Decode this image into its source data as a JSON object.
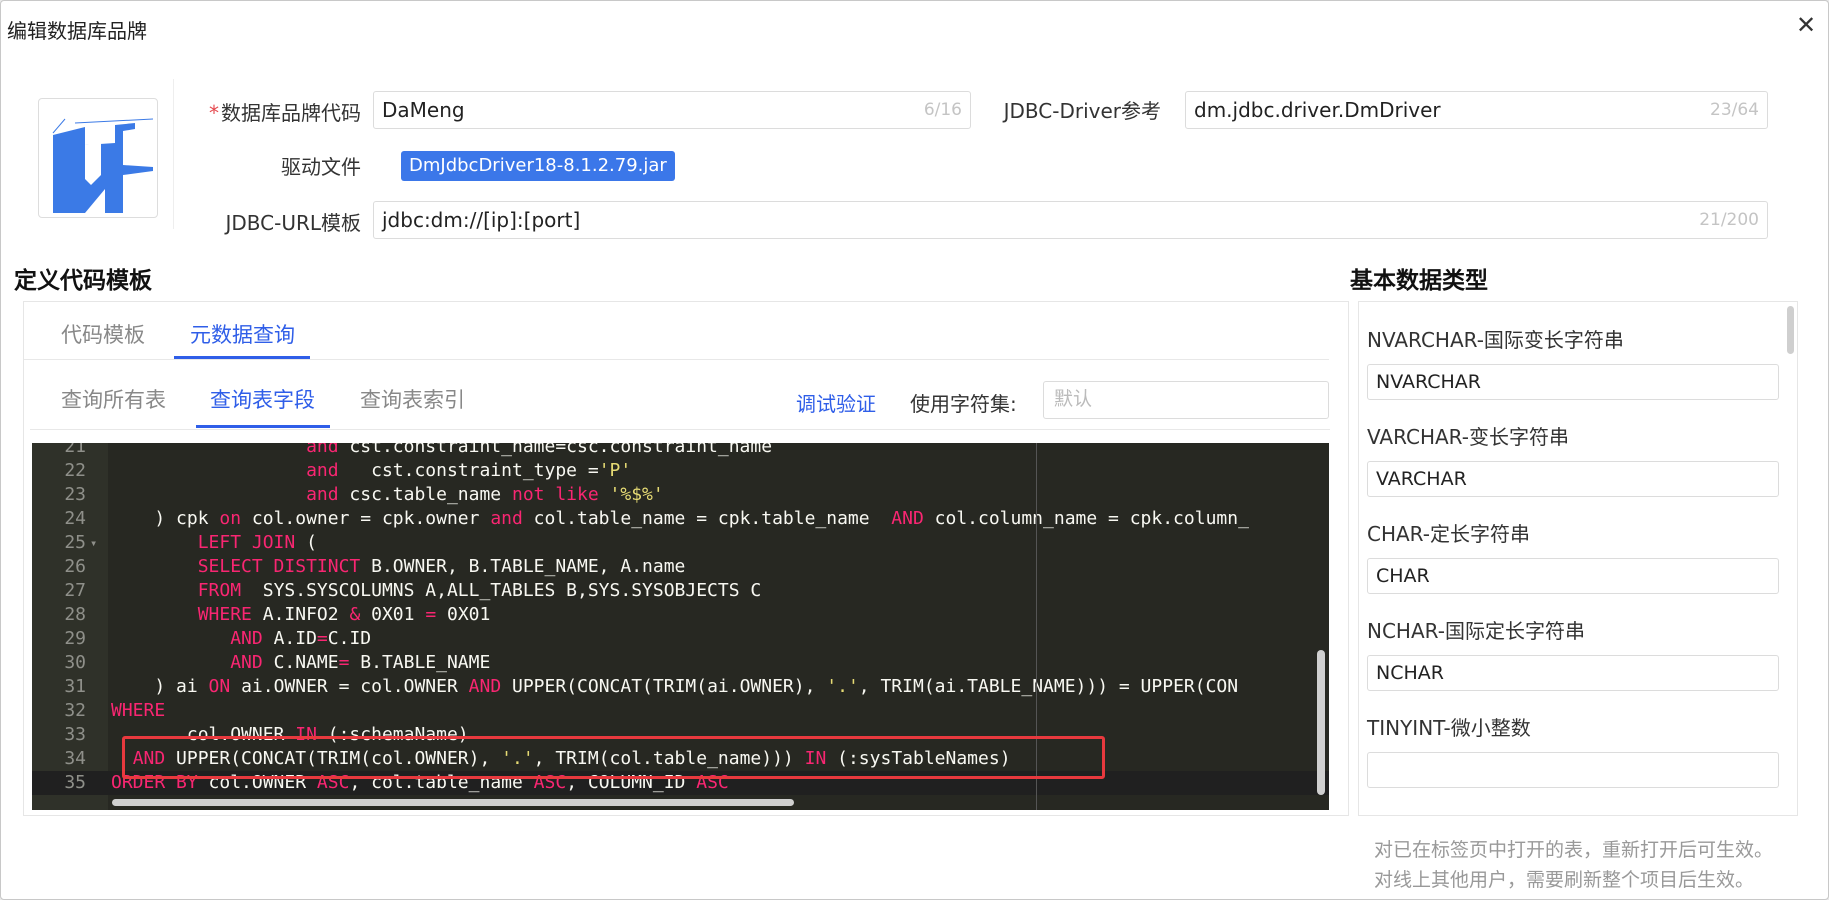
{
  "dialog": {
    "title": "编辑数据库品牌",
    "close_label": "✕"
  },
  "brand_code": {
    "label": "数据库品牌代码",
    "value": "DaMeng",
    "count": "6/16"
  },
  "jdbc_driver": {
    "label": "JDBC-Driver参考",
    "value": "dm.jdbc.driver.DmDriver",
    "count": "23/64"
  },
  "driver_file": {
    "label": "驱动文件",
    "file": "DmJdbcDriver18-8.1.2.79.jar"
  },
  "jdbc_url": {
    "label": "JDBC-URL模板",
    "value": "jdbc:dm://[ip]:[port]",
    "count": "21/200"
  },
  "sections": {
    "code_template": "定义代码模板",
    "basic_types": "基本数据类型"
  },
  "tabs_main": [
    "代码模板",
    "元数据查询"
  ],
  "tabs_sub": [
    "查询所有表",
    "查询表字段",
    "查询表索引"
  ],
  "toolbar": {
    "debug_label": "调试验证",
    "charset_label": "使用字符集:",
    "charset_placeholder": "默认"
  },
  "editor": {
    "lines": [
      {
        "n": "21",
        "t": [
          [
            "",
            "                  "
          ],
          [
            "kw",
            "and"
          ],
          [
            "",
            " cst.constraint_name=csc.constraint_name"
          ]
        ]
      },
      {
        "n": "22",
        "t": [
          [
            "",
            "                  "
          ],
          [
            "kw",
            "and"
          ],
          [
            "",
            "   cst.constraint_type ="
          ],
          [
            "str",
            "'P'"
          ]
        ]
      },
      {
        "n": "23",
        "t": [
          [
            "",
            "                  "
          ],
          [
            "kw",
            "and"
          ],
          [
            "",
            " csc.table_name "
          ],
          [
            "kw",
            "not like"
          ],
          [
            "",
            " "
          ],
          [
            "str",
            "'%$%'"
          ]
        ]
      },
      {
        "n": "24",
        "t": [
          [
            "",
            "    ) cpk "
          ],
          [
            "kw",
            "on"
          ],
          [
            "",
            " col.owner = cpk.owner "
          ],
          [
            "kw",
            "and"
          ],
          [
            "",
            " col.table_name = cpk.table_name  "
          ],
          [
            "kw",
            "AND"
          ],
          [
            "",
            " col.column_name = cpk.column_"
          ]
        ]
      },
      {
        "n": "25",
        "fold": true,
        "t": [
          [
            "",
            "        "
          ],
          [
            "kw",
            "LEFT JOIN"
          ],
          [
            "",
            " ("
          ]
        ]
      },
      {
        "n": "26",
        "t": [
          [
            "",
            "        "
          ],
          [
            "kw",
            "SELECT DISTINCT"
          ],
          [
            "",
            " B.OWNER, B.TABLE_NAME, A.name"
          ]
        ]
      },
      {
        "n": "27",
        "t": [
          [
            "",
            "        "
          ],
          [
            "kw",
            "FROM"
          ],
          [
            "",
            "  SYS.SYSCOLUMNS A,ALL_TABLES B,SYS.SYSOBJECTS C"
          ]
        ]
      },
      {
        "n": "28",
        "t": [
          [
            "",
            "        "
          ],
          [
            "kw",
            "WHERE"
          ],
          [
            "",
            " A.INFO2 "
          ],
          [
            "kw",
            "&"
          ],
          [
            "",
            " 0X01 "
          ],
          [
            "kw",
            "="
          ],
          [
            "",
            " 0X01"
          ]
        ]
      },
      {
        "n": "29",
        "t": [
          [
            "",
            "           "
          ],
          [
            "kw",
            "AND"
          ],
          [
            "",
            " A.ID"
          ],
          [
            "kw",
            "="
          ],
          [
            "",
            "C.ID"
          ]
        ]
      },
      {
        "n": "30",
        "t": [
          [
            "",
            "           "
          ],
          [
            "kw",
            "AND"
          ],
          [
            "",
            " C.NAME"
          ],
          [
            "kw",
            "="
          ],
          [
            "",
            " B.TABLE_NAME"
          ]
        ]
      },
      {
        "n": "31",
        "t": [
          [
            "",
            "    ) ai "
          ],
          [
            "kw",
            "ON"
          ],
          [
            "",
            " ai.OWNER = col.OWNER "
          ],
          [
            "kw",
            "AND"
          ],
          [
            "",
            " UPPER(CONCAT(TRIM(ai.OWNER), "
          ],
          [
            "str",
            "'.'"
          ],
          [
            "",
            ", TRIM(ai.TABLE_NAME))) = UPPER(CON"
          ]
        ]
      },
      {
        "n": "32",
        "t": [
          [
            "kw",
            "WHERE"
          ]
        ]
      },
      {
        "n": "33",
        "t": [
          [
            "",
            "       col.OWNER "
          ],
          [
            "kw",
            "IN"
          ],
          [
            "",
            " (:schemaName)"
          ]
        ]
      },
      {
        "n": "34",
        "t": [
          [
            "",
            "  "
          ],
          [
            "kw",
            "AND"
          ],
          [
            "",
            " UPPER(CONCAT(TRIM(col.OWNER), "
          ],
          [
            "str",
            "'.'"
          ],
          [
            "",
            ", TRIM(col.table_name))) "
          ],
          [
            "kw",
            "IN"
          ],
          [
            "",
            " (:sysTableNames)"
          ]
        ]
      },
      {
        "n": "35",
        "active": true,
        "t": [
          [
            "kw",
            "ORDER BY"
          ],
          [
            "",
            " col.OWNER "
          ],
          [
            "kw",
            "ASC"
          ],
          [
            "",
            ", col.table_name "
          ],
          [
            "kw",
            "ASC"
          ],
          [
            "",
            ", COLUMN_ID "
          ],
          [
            "kw",
            "ASC"
          ]
        ]
      }
    ]
  },
  "basic_types": [
    {
      "label": "NVARCHAR-国际变长字符串",
      "value": "NVARCHAR"
    },
    {
      "label": "VARCHAR-变长字符串",
      "value": "VARCHAR"
    },
    {
      "label": "CHAR-定长字符串",
      "value": "CHAR"
    },
    {
      "label": "NCHAR-国际定长字符串",
      "value": "NCHAR"
    },
    {
      "label": "TINYINT-微小整数",
      "value": ""
    }
  ],
  "notes": [
    "对已在标签页中打开的表，重新打开后可生效。",
    "对线上其他用户，需要刷新整个项目后生效。"
  ],
  "colors": {
    "accent": "#2f5ee8",
    "tag": "#3b77e9",
    "editor_bg": "#272822",
    "keyword": "#f92672",
    "string": "#e6db74",
    "highlight": "#e8393e"
  }
}
